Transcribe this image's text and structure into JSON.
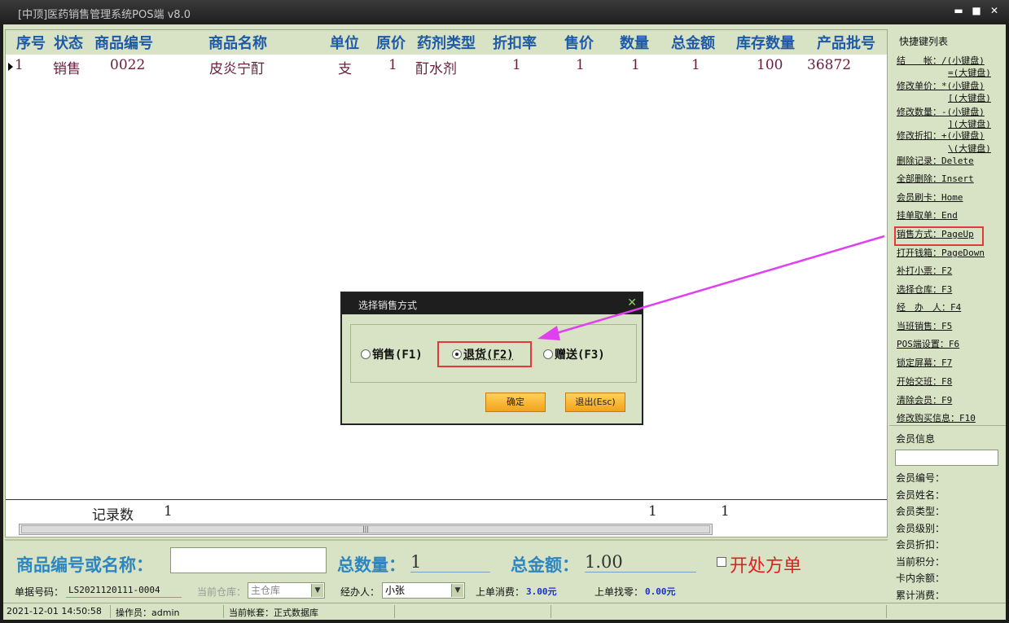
{
  "window": {
    "title": "[中顶]医药销售管理系统POS端 v8.0",
    "min": "▬",
    "max": "■",
    "close": "✕"
  },
  "grid": {
    "headers": [
      "序号",
      "状态",
      "商品编号",
      "商品名称",
      "单位",
      "原价",
      "药剂类型",
      "折扣率",
      "售价",
      "数量",
      "总金额",
      "库存数量",
      "产品批号"
    ],
    "row": [
      "1",
      "销售",
      "0022",
      "皮炎宁酊",
      "支",
      "1",
      "酊水剂",
      "1",
      "1",
      "1",
      "1",
      "100",
      "36872"
    ],
    "footer_label": "记录数",
    "footer_count": "1",
    "footer_qty": "1",
    "footer_total": "1",
    "scroll_grip": "|||"
  },
  "shortcuts": {
    "title": "快捷键列表",
    "items": [
      "结　　帐：/(小键盘)",
      "=(大键盘)",
      "修改单价：*(小键盘)",
      "[(大键盘)",
      "修改数量：-(小键盘)",
      "](大键盘)",
      "修改折扣：+(小键盘)",
      "\\(大键盘)",
      "删除记录：Delete",
      "全部删除：Insert",
      "会员刷卡：Home",
      "挂单取单：End",
      "销售方式：PageUp",
      "打开钱箱：PageDown",
      "补打小票：F2",
      "选择仓库：F3",
      "经　办　人：F4",
      "当班销售：F5",
      "POS端设置：F6",
      "锁定屏幕：F7",
      "开始交班：F8",
      "清除会员：F9",
      "修改购买信息：F10"
    ]
  },
  "member": {
    "title": "会员信息",
    "fields": [
      "会员编号：",
      "会员姓名：",
      "会员类型：",
      "会员级别：",
      "会员折扣：",
      "当前积分：",
      "卡内余额：",
      "累计消费："
    ]
  },
  "input_bar": {
    "search_label": "商品编号或名称：",
    "search_value": "",
    "qty_label": "总数量：",
    "qty_value": "1",
    "amount_label": "总金额：",
    "amount_value": "1.00",
    "prescription_label": "开处方单"
  },
  "info_bar": {
    "order_label": "单据号码：",
    "order_value": "LS2021120111-0004",
    "warehouse_label": "当前仓库：",
    "warehouse_value": "主仓库",
    "handler_label": "经办人：",
    "handler_value": "小张",
    "last_spend_label": "上单消费：",
    "last_spend_value": "3.00元",
    "last_change_label": "上单找零：",
    "last_change_value": "0.00元"
  },
  "status_bar": {
    "datetime": "2021-12-01 14:50:58",
    "operator": "操作员：admin",
    "account": "当前帐套：正式数据库"
  },
  "dialog": {
    "title": "选择销售方式",
    "close": "✕",
    "options": [
      "销售(F1)",
      "退货(F2)",
      "赠送(F3)"
    ],
    "selected_index": 1,
    "ok": "确定",
    "exit": "退出(Esc)"
  },
  "colors": {
    "highlight": "#e23a3a",
    "arrow": "#e040f0",
    "header_text": "#1d5aa8",
    "row_text": "#6b1e3c"
  }
}
